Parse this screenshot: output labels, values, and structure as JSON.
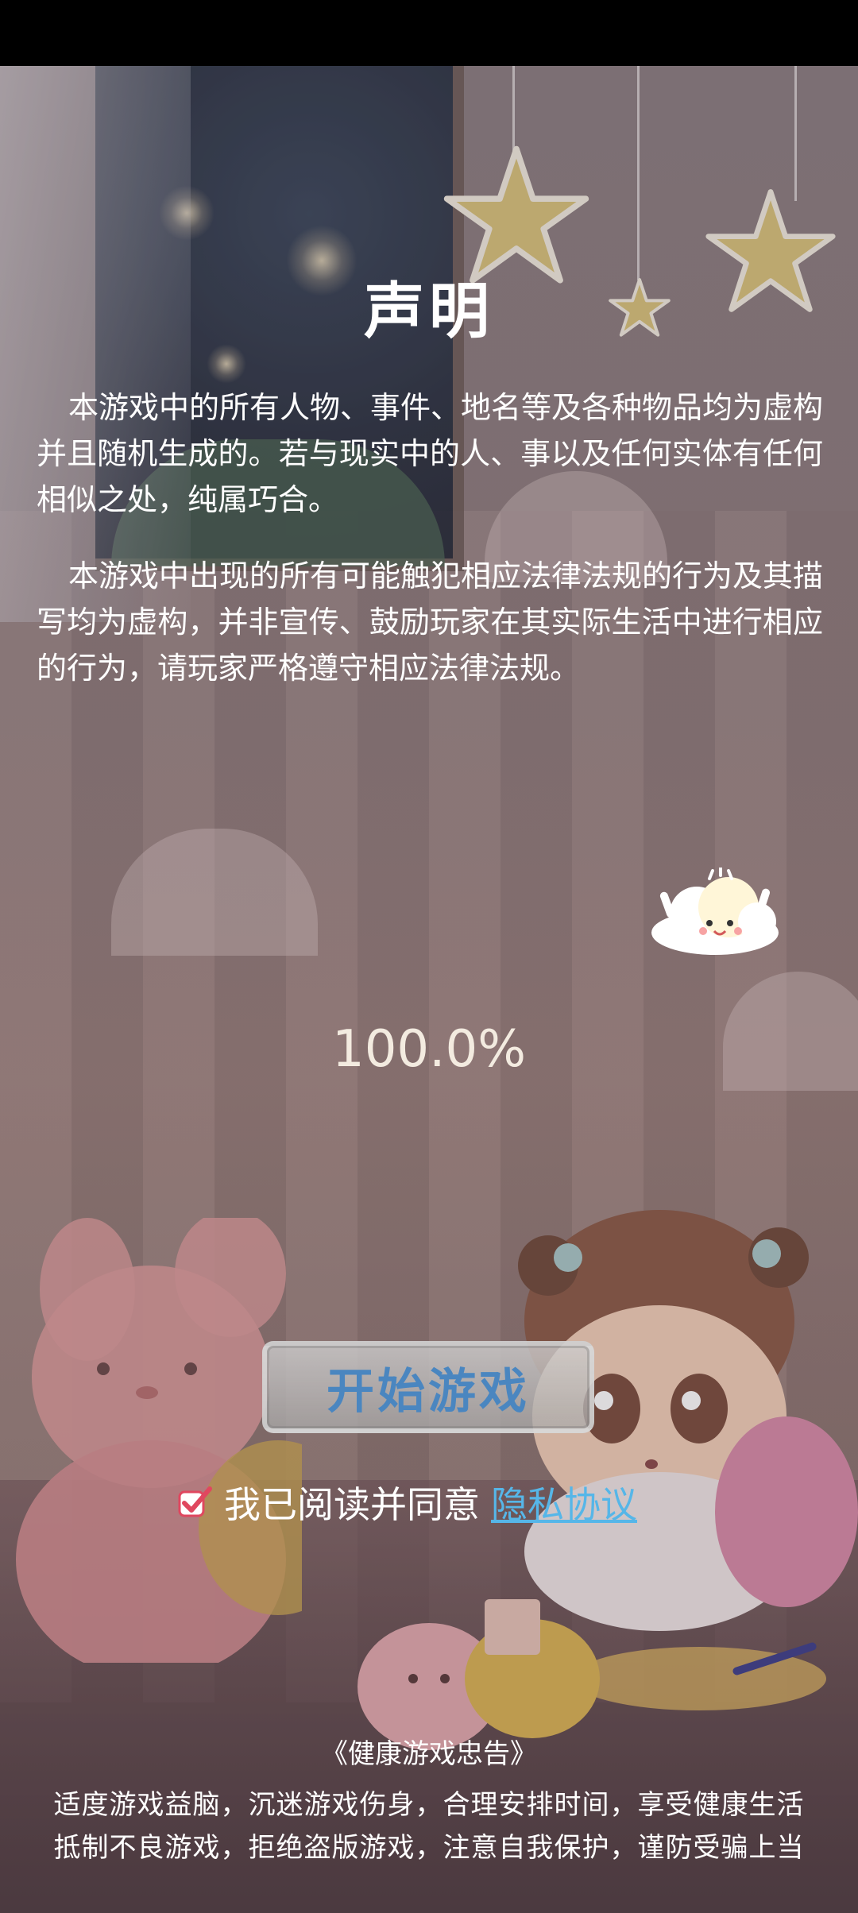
{
  "notice": {
    "title": "声明",
    "paragraphs": [
      "本游戏中的所有人物、事件、地名等及各种物品均为虚构并且随机生成的。若与现实中的人、事以及任何实体有任何相似之处，纯属巧合。",
      "本游戏中出现的所有可能触犯相应法律法规的行为及其描写均为虚构，并非宣传、鼓励玩家在其实际生活中进行相应的行为，请玩家严格遵守相应法律法规。"
    ]
  },
  "loading": {
    "progress_text": "100.0%",
    "progress_value": 1.0
  },
  "start_button": {
    "label": "开始游戏"
  },
  "agreement": {
    "checked": true,
    "text": "我已阅读并同意",
    "link_label": "隐私协议"
  },
  "health_advice": {
    "title": "《健康游戏忠告》",
    "lines": [
      "适度游戏益脑，沉迷游戏伤身，合理安排时间，享受健康生活",
      "抵制不良游戏，拒绝盗版游戏，注意自我保护，谨防受骗上当"
    ]
  },
  "colors": {
    "start_button_text": "#4a86c0",
    "link": "#56b6e8",
    "checkbox": "#e0475f"
  },
  "icons": {
    "checkbox": "checkbox-checked-icon",
    "mascot": "cloud-mascot-icon"
  }
}
